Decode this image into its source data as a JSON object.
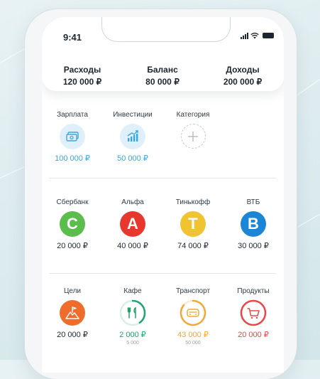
{
  "status_bar": {
    "time": "9:41"
  },
  "summary": {
    "expenses": {
      "label": "Расходы",
      "value": "120 000 ₽"
    },
    "balance": {
      "label": "Баланс",
      "value": "80 000 ₽"
    },
    "income": {
      "label": "Доходы",
      "value": "200 000 ₽"
    }
  },
  "income_sources": [
    {
      "label": "Зарплата",
      "amount": "100 000 ₽",
      "icon": "cash-icon",
      "color": "#3aa7e0",
      "bg": "#dff0fa"
    },
    {
      "label": "Инвестиции",
      "amount": "50 000 ₽",
      "icon": "chart-growth-icon",
      "color": "#3aa7e0",
      "bg": "#dff0fa"
    },
    {
      "label": "Категория",
      "amount": "",
      "icon": "add-icon"
    }
  ],
  "accounts": [
    {
      "label": "Сбербанк",
      "letter": "C",
      "amount": "20 000 ₽",
      "color": "#5bbd4c"
    },
    {
      "label": "Альфа",
      "letter": "A",
      "amount": "40 000 ₽",
      "color": "#e7382e"
    },
    {
      "label": "Тинькофф",
      "letter": "T",
      "amount": "74 000 ₽",
      "color": "#f0c431"
    },
    {
      "label": "ВТБ",
      "letter": "B",
      "amount": "30 000 ₽",
      "color": "#1b86d6"
    }
  ],
  "expense_categories": [
    {
      "label": "Цели",
      "amount": "20 000 ₽",
      "sub": "",
      "icon": "flag-mountain-icon",
      "color": "#ef6d2c",
      "amount_color": "#1d2630"
    },
    {
      "label": "Кафе",
      "amount": "2 000 ₽",
      "sub": "5 000",
      "icon": "cutlery-icon",
      "color": "#22a36e",
      "amount_color": "#22a36e",
      "progress": 0.4
    },
    {
      "label": "Транспорт",
      "amount": "43 000 ₽",
      "sub": "50 000",
      "icon": "car-icon",
      "color": "#f0a93a",
      "amount_color": "#f0a93a",
      "progress": 0.86
    },
    {
      "label": "Продукты",
      "amount": "20 000 ₽",
      "sub": "",
      "icon": "cart-icon",
      "color": "#e9474b",
      "amount_color": "#e9474b",
      "progress": 1.0
    }
  ]
}
